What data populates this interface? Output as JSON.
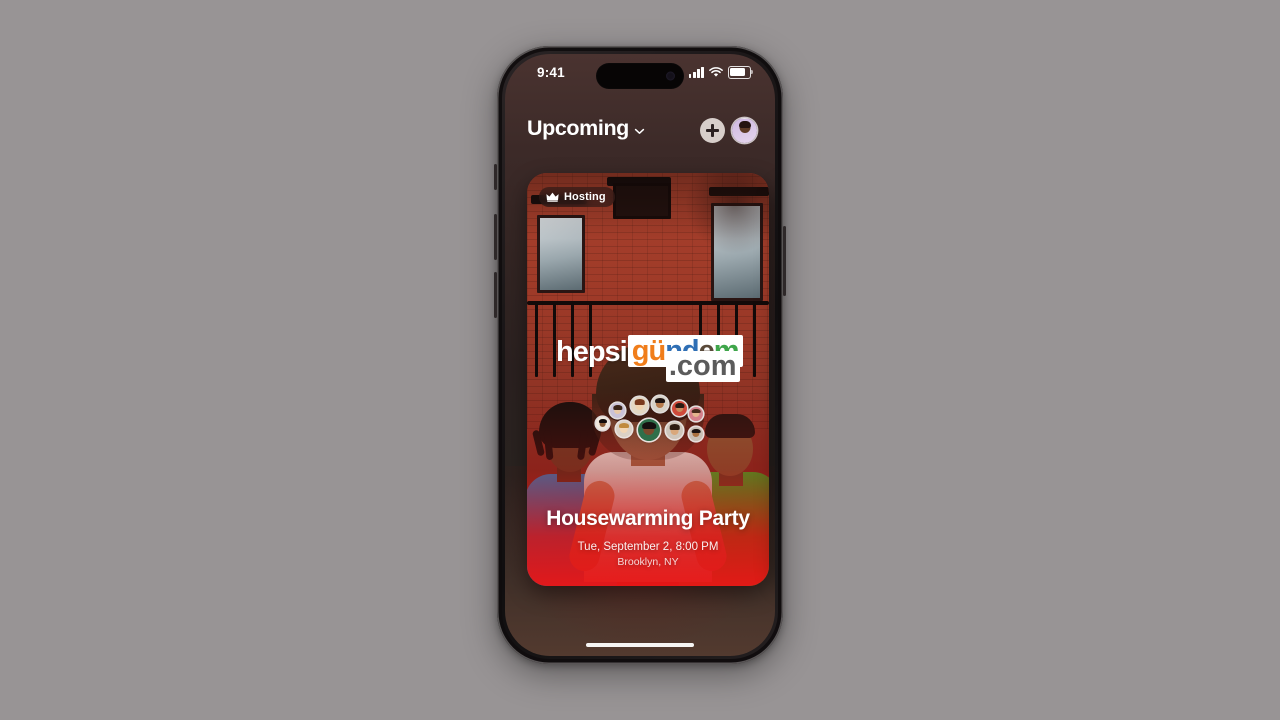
{
  "background": {
    "color": "#989495"
  },
  "phone": {
    "status_bar": {
      "time": "9:41",
      "icons": [
        "cellular-signal-icon",
        "wifi-icon",
        "battery-icon"
      ]
    },
    "nav": {
      "title": "Upcoming",
      "chevron_icon": "chevron-down-icon",
      "add_button_label": "+",
      "add_icon": "plus-icon",
      "profile_icon": "profile-avatar-icon"
    },
    "event_card": {
      "badge": {
        "icon": "crown-icon",
        "label": "Hosting"
      },
      "title": "Housewarming Party",
      "date": "Tue, September 2, 8:00 PM",
      "location": "Brooklyn, NY",
      "attendees": [
        {
          "name": "attendee-1",
          "skin": "#e8c9a8",
          "hair": "#3a2418",
          "shirt": "#c9c2d8"
        },
        {
          "name": "attendee-2",
          "skin": "#f0d2ae",
          "hair": "#7a3a1e",
          "shirt": "#e4d8c4"
        },
        {
          "name": "attendee-3",
          "skin": "#b57a4c",
          "hair": "#1d1210",
          "shirt": "#d8d2c8"
        },
        {
          "name": "attendee-4",
          "skin": "#c98a5c",
          "hair": "#2a1a12",
          "shirt": "#cf4a3a"
        },
        {
          "name": "attendee-5",
          "skin": "#e2b48c",
          "hair": "#45291a",
          "shirt": "#d4808a"
        },
        {
          "name": "attendee-6",
          "skin": "#8a5a34",
          "hair": "#140d0b",
          "shirt": "#f0e8de"
        },
        {
          "name": "attendee-7",
          "skin": "#f2d6b4",
          "hair": "#c08a3e",
          "shirt": "#dcd2c6"
        },
        {
          "name": "attendee-8",
          "skin": "#7a4a2c",
          "hair": "#161010",
          "shirt": "#2f6f4a"
        },
        {
          "name": "attendee-9",
          "skin": "#d9a87c",
          "hair": "#2e1c12",
          "shirt": "#cfc6bb"
        },
        {
          "name": "attendee-10",
          "skin": "#a9703f",
          "hair": "#1a1110",
          "shirt": "#c8bfb4"
        }
      ],
      "colors": {
        "glow": "#e81616",
        "badge_bg": "rgba(38,24,22,.62)"
      }
    },
    "next_card": {
      "label": "next-event-card"
    },
    "home_indicator": "home-indicator"
  },
  "watermark": {
    "part1": "hepsi",
    "letters": [
      "g",
      "ü",
      "n",
      "d",
      "e",
      "m"
    ],
    "suffix": ".com"
  }
}
